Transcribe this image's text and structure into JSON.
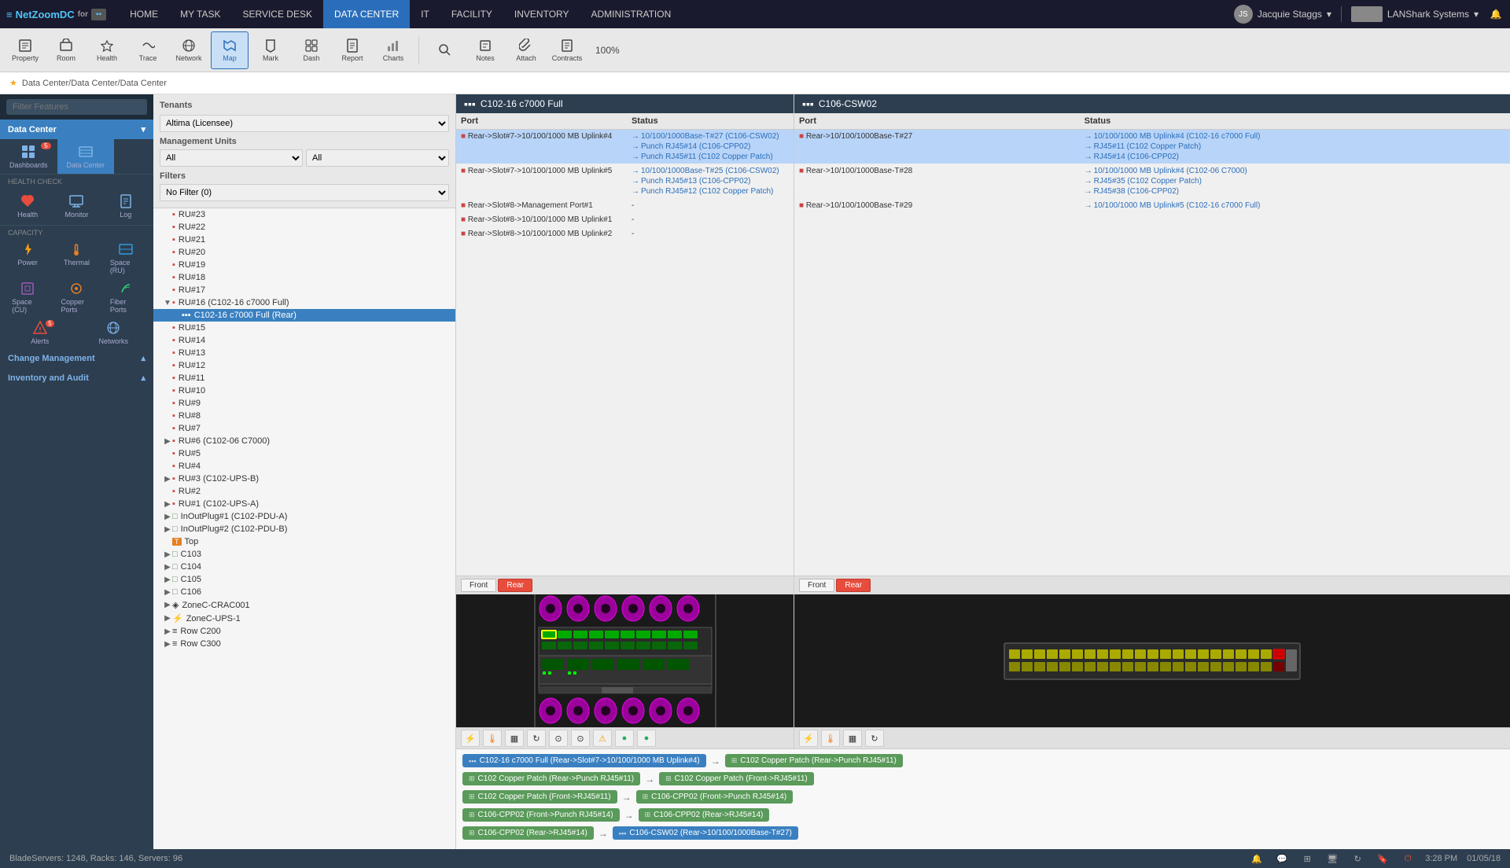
{
  "app": {
    "name": "NetZoomDC",
    "for_text": "for",
    "logo_icon": "nz"
  },
  "nav": {
    "items": [
      {
        "label": "HOME",
        "active": false
      },
      {
        "label": "MY TASK",
        "active": false
      },
      {
        "label": "SERVICE DESK",
        "active": false
      },
      {
        "label": "DATA CENTER",
        "active": true
      },
      {
        "label": "IT",
        "active": false
      },
      {
        "label": "FACILITY",
        "active": false
      },
      {
        "label": "INVENTORY",
        "active": false
      },
      {
        "label": "ADMINISTRATION",
        "active": false
      }
    ],
    "user": "Jacquie Staggs",
    "company": "LANShark Systems"
  },
  "toolbar": {
    "items": [
      {
        "label": "Property",
        "icon": "prop"
      },
      {
        "label": "Room",
        "icon": "room"
      },
      {
        "label": "Health",
        "icon": "health"
      },
      {
        "label": "Trace",
        "icon": "trace"
      },
      {
        "label": "Network",
        "icon": "network"
      },
      {
        "label": "Map",
        "icon": "map",
        "active": true
      },
      {
        "label": "Mark",
        "icon": "mark"
      },
      {
        "label": "Dash",
        "icon": "dash"
      },
      {
        "label": "Report",
        "icon": "report"
      },
      {
        "label": "Charts",
        "icon": "charts"
      },
      {
        "label": "Notes",
        "icon": "notes"
      },
      {
        "label": "Attach",
        "icon": "attach"
      },
      {
        "label": "Contracts",
        "icon": "contracts"
      }
    ],
    "zoom": "100%",
    "search_icon": "search"
  },
  "breadcrumb": "Data Center/Data Center/Data Center",
  "sidebar": {
    "search_placeholder": "Filter Features",
    "data_center_label": "Data Center",
    "health_check_label": "HEALTH CHECK",
    "health_items": [
      {
        "label": "Health",
        "icon": "❤"
      },
      {
        "label": "Monitor",
        "icon": "📊"
      },
      {
        "label": "Log",
        "icon": "📋"
      }
    ],
    "capacity_label": "CAPACITY",
    "capacity_items": [
      {
        "label": "Power",
        "icon": "⚡"
      },
      {
        "label": "Thermal",
        "icon": "🌡"
      },
      {
        "label": "Space (RU)",
        "icon": "📦"
      }
    ],
    "capacity_items2": [
      {
        "label": "Space (CU)",
        "icon": "📐"
      },
      {
        "label": "Copper Ports",
        "icon": "🔌"
      },
      {
        "label": "Fiber Ports",
        "icon": "💡"
      }
    ],
    "menu_items": [
      {
        "label": "Change Management",
        "expanded": true
      },
      {
        "label": "Inventory and Audit",
        "expanded": true
      }
    ],
    "alerts_badge": "5"
  },
  "tree": {
    "items": [
      {
        "indent": 0,
        "label": "RU#23",
        "icon": "▪",
        "type": "ru"
      },
      {
        "indent": 0,
        "label": "RU#22",
        "icon": "▪",
        "type": "ru"
      },
      {
        "indent": 0,
        "label": "RU#21",
        "icon": "▪",
        "type": "ru"
      },
      {
        "indent": 0,
        "label": "RU#20",
        "icon": "▪",
        "type": "ru"
      },
      {
        "indent": 0,
        "label": "RU#19",
        "icon": "▪",
        "type": "ru"
      },
      {
        "indent": 0,
        "label": "RU#18",
        "icon": "▪",
        "type": "ru"
      },
      {
        "indent": 0,
        "label": "RU#17",
        "icon": "▪",
        "type": "ru"
      },
      {
        "indent": 0,
        "label": "RU#16 (C102-16 c7000 Full)",
        "icon": "▼",
        "type": "ru-expanded"
      },
      {
        "indent": 1,
        "label": "C102-16 c7000 Full (Rear)",
        "icon": "▪",
        "type": "device",
        "selected": true,
        "highlighted": true
      },
      {
        "indent": 0,
        "label": "RU#15",
        "icon": "▪",
        "type": "ru"
      },
      {
        "indent": 0,
        "label": "RU#14",
        "icon": "▪",
        "type": "ru"
      },
      {
        "indent": 0,
        "label": "RU#13",
        "icon": "▪",
        "type": "ru"
      },
      {
        "indent": 0,
        "label": "RU#12",
        "icon": "▪",
        "type": "ru"
      },
      {
        "indent": 0,
        "label": "RU#11",
        "icon": "▪",
        "type": "ru"
      },
      {
        "indent": 0,
        "label": "RU#10",
        "icon": "▪",
        "type": "ru"
      },
      {
        "indent": 0,
        "label": "RU#9",
        "icon": "▪",
        "type": "ru"
      },
      {
        "indent": 0,
        "label": "RU#8",
        "icon": "▪",
        "type": "ru"
      },
      {
        "indent": 0,
        "label": "RU#7",
        "icon": "▪",
        "type": "ru"
      },
      {
        "indent": 0,
        "label": "RU#6 (C102-06 C7000)",
        "icon": "▶",
        "type": "ru-collapsed"
      },
      {
        "indent": 0,
        "label": "RU#5",
        "icon": "▪",
        "type": "ru"
      },
      {
        "indent": 0,
        "label": "RU#4",
        "icon": "▪",
        "type": "ru"
      },
      {
        "indent": 0,
        "label": "RU#3 (C102-UPS-B)",
        "icon": "▶",
        "type": "ru-collapsed"
      },
      {
        "indent": 0,
        "label": "RU#2",
        "icon": "▪",
        "type": "ru"
      },
      {
        "indent": 0,
        "label": "RU#1 (C102-UPS-A)",
        "icon": "▶",
        "type": "ru-collapsed"
      },
      {
        "indent": 0,
        "label": "InOutPlug#1 (C102-PDU-A)",
        "icon": "▶",
        "type": "ru-collapsed"
      },
      {
        "indent": 0,
        "label": "InOutPlug#2 (C102-PDU-B)",
        "icon": "▶",
        "type": "ru-collapsed"
      },
      {
        "indent": 0,
        "label": "Top",
        "icon": "T",
        "type": "top"
      },
      {
        "indent": 0,
        "label": "C103",
        "icon": "▶",
        "type": "container"
      },
      {
        "indent": 0,
        "label": "C104",
        "icon": "▶",
        "type": "container"
      },
      {
        "indent": 0,
        "label": "C105",
        "icon": "▶",
        "type": "container"
      },
      {
        "indent": 0,
        "label": "C106",
        "icon": "▶",
        "type": "container"
      },
      {
        "indent": 0,
        "label": "ZoneC-CRAC001",
        "icon": "▶",
        "type": "zone"
      },
      {
        "indent": 0,
        "label": "ZoneC-UPS-1",
        "icon": "▶",
        "type": "zone"
      },
      {
        "indent": 0,
        "label": "Row C200",
        "icon": "▶",
        "type": "row"
      },
      {
        "indent": 0,
        "label": "Row C300",
        "icon": "▶",
        "type": "row"
      }
    ]
  },
  "left_panel": {
    "title": "C102-16 c7000 Full",
    "title_icon": "device",
    "columns": [
      "Port",
      "Status"
    ],
    "rows": [
      {
        "port": "Rear->Slot#7->10/100/1000 MB Uplink#4",
        "status_links": [
          "10/100/1000Base-T#27 (C106-CSW02)",
          "Punch RJ45#14 (C106-CPP02)",
          "Punch RJ45#11 (C102 Copper Patch)"
        ],
        "selected": true
      },
      {
        "port": "Rear->Slot#7->10/100/1000 MB Uplink#5",
        "status_links": [
          "10/100/1000Base-T#25 (C106-CSW02)",
          "Punch RJ45#13 (C106-CPP02)",
          "Punch RJ45#12 (C102 Copper Patch)"
        ],
        "selected": false
      },
      {
        "port": "Rear->Slot#8->Management Port#1",
        "status_links": [
          "-"
        ],
        "selected": false
      },
      {
        "port": "Rear->Slot#8->10/100/1000 MB Uplink#1",
        "status_links": [
          "-"
        ],
        "selected": false
      },
      {
        "port": "Rear->Slot#8->10/100/1000 MB Uplink#2",
        "status_links": [
          "-"
        ],
        "selected": false
      }
    ],
    "front_rear_tabs": [
      {
        "label": "Front",
        "active": false
      },
      {
        "label": "Rear",
        "active": true
      }
    ],
    "device_toolbar_icons": [
      "🔥",
      "🌡",
      "📦",
      "🔄",
      "📡",
      "⚡",
      "⚠",
      "🟢",
      "🟢"
    ]
  },
  "right_panel": {
    "title": "C106-CSW02",
    "title_icon": "device",
    "columns": [
      "Port",
      "Status"
    ],
    "rows": [
      {
        "port": "Rear->10/100/1000Base-T#27",
        "status_links": [
          "10/100/1000 MB Uplink#4 (C102-16 c7000 Full)",
          "RJ45#11 (C102 Copper Patch)",
          "RJ45#14 (C106-CPP02)"
        ],
        "selected": true
      },
      {
        "port": "Rear->10/100/1000Base-T#28",
        "status_links": [
          "10/100/1000 MB Uplink#4 (C102-06 C7000)",
          "RJ45#35 (C102 Copper Patch)",
          "RJ45#38 (C106-CPP02)"
        ],
        "selected": false
      },
      {
        "port": "Rear->10/100/1000Base-T#29",
        "status_links": [
          "10/100/1000 MB Uplink#5 (C102-16 c7000 Full)"
        ],
        "selected": false
      }
    ],
    "front_rear_tabs": [
      {
        "label": "Front",
        "active": false
      },
      {
        "label": "Rear",
        "active": true
      }
    ],
    "device_toolbar_icons": [
      "🔥",
      "🌡",
      "📦",
      "🔄"
    ]
  },
  "path_rows": [
    {
      "nodes": [
        {
          "label": "C102-16 c7000 Full (Rear->Slot#7->10/100/1000 MB Uplink#4)",
          "type": "device"
        },
        {
          "arrow": "→"
        },
        {
          "label": "C102 Copper Patch (Rear->Punch RJ45#11)",
          "type": "patch"
        }
      ]
    },
    {
      "nodes": [
        {
          "label": "C102 Copper Patch (Rear->Punch RJ45#11)",
          "type": "patch"
        },
        {
          "arrow": "→"
        },
        {
          "label": "C102 Copper Patch (Front->RJ45#11)",
          "type": "patch"
        }
      ]
    },
    {
      "nodes": [
        {
          "label": "C102 Copper Patch (Front->RJ45#11)",
          "type": "patch"
        },
        {
          "arrow": "→"
        },
        {
          "label": "C106-CPP02 (Front->Punch RJ45#14)",
          "type": "patch"
        }
      ]
    },
    {
      "nodes": [
        {
          "label": "C106-CPP02 (Front->Punch RJ45#14)",
          "type": "patch"
        },
        {
          "arrow": "→"
        },
        {
          "label": "C106-CPP02 (Rear->RJ45#14)",
          "type": "patch"
        }
      ]
    },
    {
      "nodes": [
        {
          "label": "C106-CPP02 (Rear->RJ45#14)",
          "type": "patch"
        },
        {
          "arrow": "→"
        },
        {
          "label": "C106-CSW02 (Rear->10/100/1000Base-T#27)",
          "type": "device"
        }
      ]
    }
  ],
  "status_bar": {
    "text": "BladeServers: 1248, Racks: 146, Servers: 96",
    "time": "3:28 PM",
    "date": "01/05/18"
  }
}
